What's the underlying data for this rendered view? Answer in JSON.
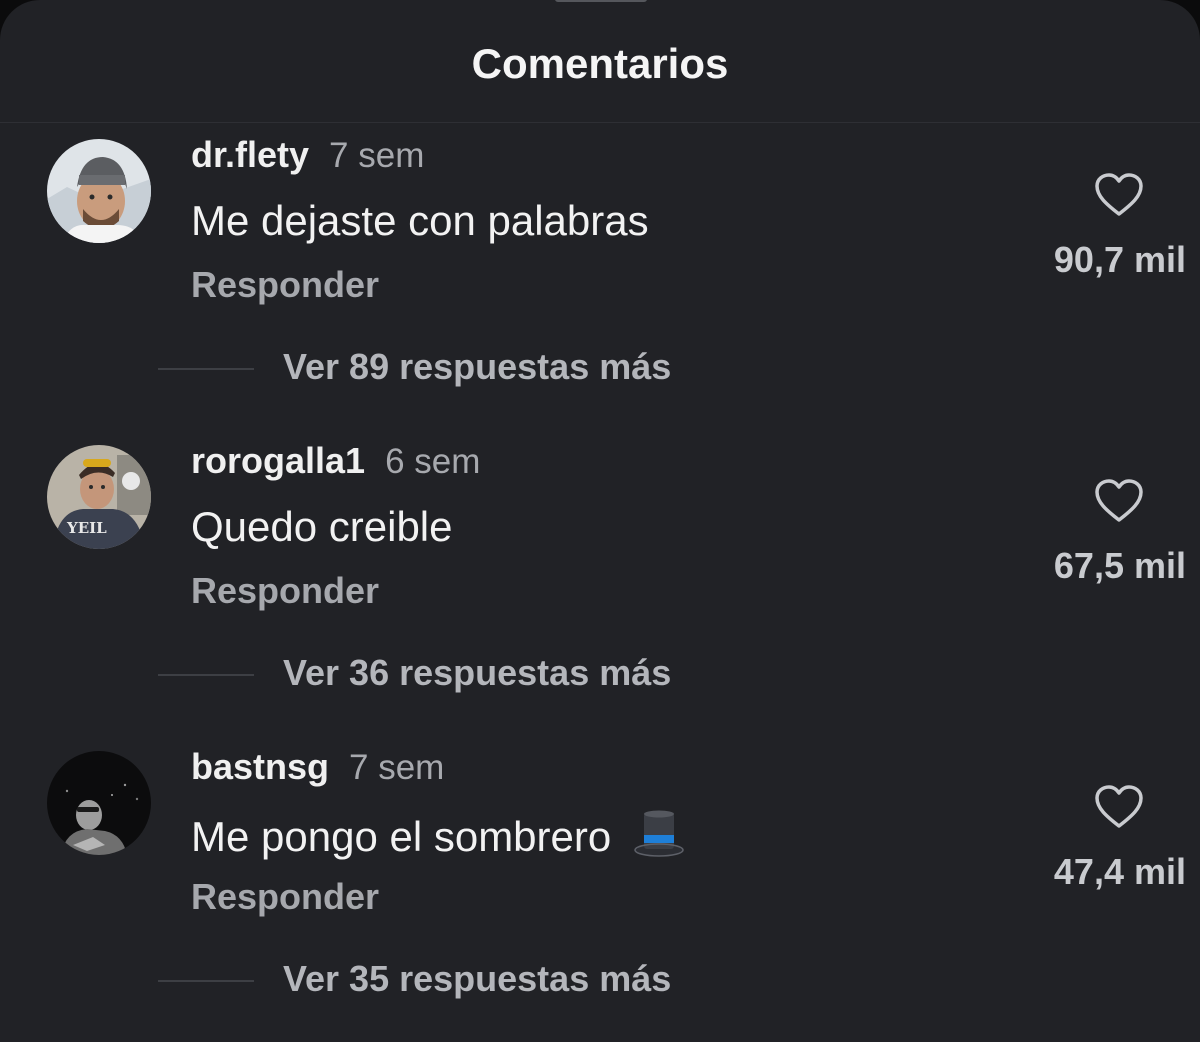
{
  "header": {
    "title": "Comentarios"
  },
  "comments": [
    {
      "username": "dr.flety",
      "time": "7 sem",
      "text": "Me dejaste con palabras",
      "reply_label": "Responder",
      "likes": "90,7 mil",
      "view_replies": "Ver 89 respuestas más"
    },
    {
      "username": "rorogalla1",
      "time": "6 sem",
      "text": "Quedo creible",
      "reply_label": "Responder",
      "likes": "67,5 mil",
      "view_replies": "Ver 36 respuestas más"
    },
    {
      "username": "bastnsg",
      "time": "7 sem",
      "text": "Me pongo el sombrero",
      "emoji": "top-hat-emoji",
      "reply_label": "Responder",
      "likes": "47,4 mil",
      "view_replies": "Ver 35 respuestas más"
    }
  ],
  "icons": {
    "like": "heart-outline-icon"
  },
  "colors": {
    "background": "#212226",
    "text_primary": "#f2f2f2",
    "text_secondary": "#a6a8ad"
  }
}
